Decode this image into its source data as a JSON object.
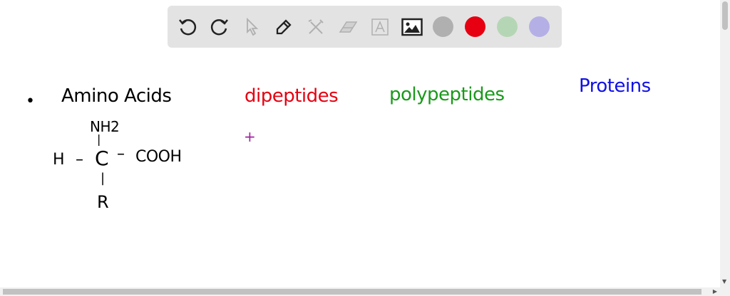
{
  "toolbar": {
    "tools": [
      "undo-icon",
      "redo-icon",
      "select-icon",
      "pen-icon",
      "tools-icon",
      "eraser-icon",
      "text-icon",
      "image-icon"
    ],
    "colors": [
      "#b0b0b0",
      "#e60012",
      "#b5d6b5",
      "#b4b0e6"
    ]
  },
  "canvas": {
    "bullet": "•",
    "amino_acids": "Amino Acids",
    "structure": {
      "top": "NH2",
      "left": "H",
      "center": "C",
      "right": "COOH",
      "bottom": "R",
      "bond_h1": "–",
      "bond_h2": "–",
      "bond_v1": "|",
      "bond_v2": "|"
    },
    "dipeptides": "dipeptides",
    "polypeptides": "polypeptides",
    "proteins": "Proteins",
    "plus": "+"
  }
}
